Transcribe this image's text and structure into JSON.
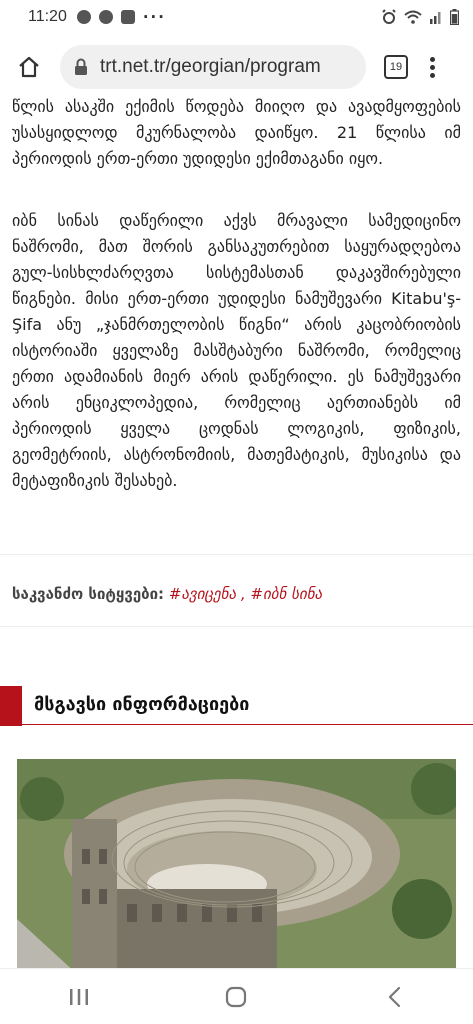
{
  "status_bar": {
    "time": "11:20",
    "left_icons": [
      "messenger-icon",
      "messenger-icon",
      "image-icon",
      "more-dots-icon"
    ],
    "more_dots": "···",
    "right_icons": [
      "alarm-icon",
      "wifi-icon",
      "signal-icon",
      "battery-icon"
    ]
  },
  "browser": {
    "url": "trt.net.tr/georgian/program",
    "tab_count": "19"
  },
  "article": {
    "para_top": "წლის ასაკში ექიმის წოდება მიიღო და ავადმყოფების უსასყიდლოდ მკურნალობა დაიწყო. 21 წლისა იმ პერიოდის ერთ-ერთი უდიდესი ექიმთაგანი იყო.",
    "para_main": "იბნ სინას დაწერილი აქვს მრავალი სამედიცინო ნაშრომი, მათ შორის განსაკუთრებით საყურადღებოა გულ-სისხლძარღვთა სისტემასთან დაკავშირებული წიგნები. მისი ერთ-ერთი უდიდესი ნამუშევარი Kitabu'ş-Şifa ანუ „ჯანმრთელობის წიგნი“ არის კაცობრიობის ისტორიაში ყველაზე მასშტაბური ნაშრომი, რომელიც ერთი ადამიანის მიერ არის დაწერილი. ეს ნამუშევარი არის ენციკლოპედია, რომელიც აერთიანებს იმ პერიოდის ყველა ცოდნას ლოგიკის, ფიზიკის, გეომეტრიის, ასტრონომიის, მათემატიკის, მუსიკისა და მეტაფიზიკის შესახებ."
  },
  "tags": {
    "label": "საკვანძო სიტყვები:",
    "items": [
      "#ავიცენა",
      "#იბნ სინა"
    ],
    "separator": " , "
  },
  "related": {
    "title": "მსგავსი ინფორმაციები"
  },
  "nav_bar": {
    "buttons": [
      "recent-apps-icon",
      "home-icon",
      "back-icon"
    ]
  },
  "colors": {
    "accent": "#b5121b",
    "text": "#222222",
    "url_pill": "#f0f0f0"
  }
}
